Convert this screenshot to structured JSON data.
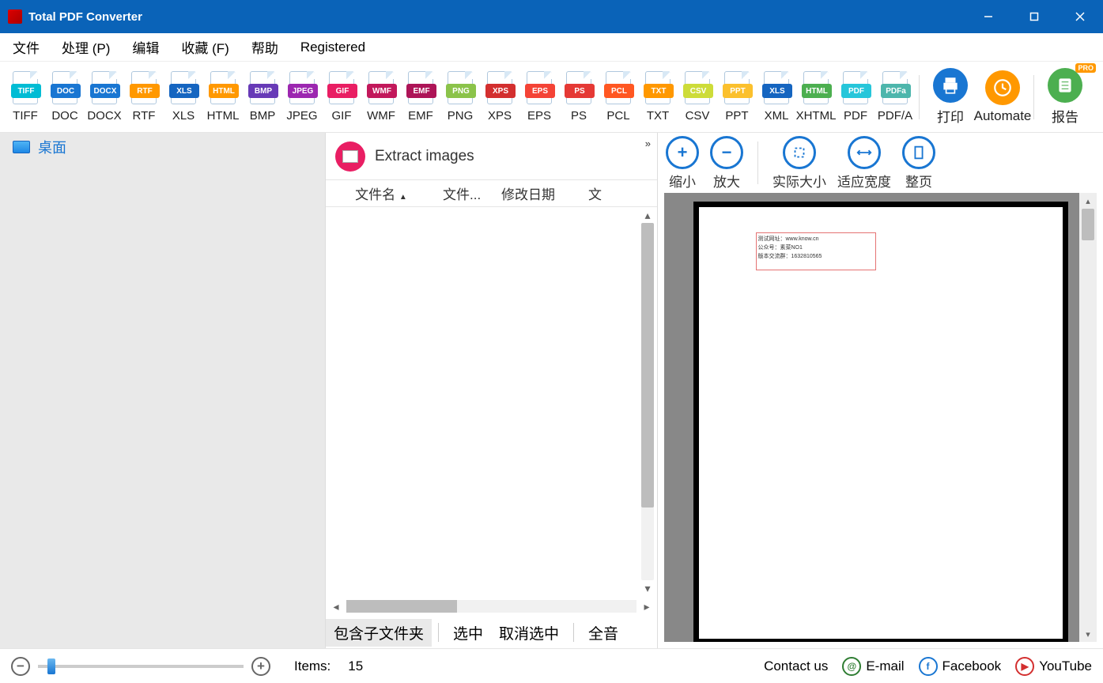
{
  "window": {
    "title": "Total PDF Converter"
  },
  "menu": {
    "file": "文件",
    "process": "处理 (P)",
    "edit": "编辑",
    "favorites": "收藏 (F)",
    "help": "帮助",
    "registered": "Registered"
  },
  "formats": [
    {
      "label": "TIFF",
      "badge": "TIFF",
      "color": "#00bcd4"
    },
    {
      "label": "DOC",
      "badge": "DOC",
      "color": "#1976d2"
    },
    {
      "label": "DOCX",
      "badge": "DOCX",
      "color": "#1976d2"
    },
    {
      "label": "RTF",
      "badge": "RTF",
      "color": "#ff9800"
    },
    {
      "label": "XLS",
      "badge": "XLS",
      "color": "#1565c0"
    },
    {
      "label": "HTML",
      "badge": "HTML",
      "color": "#ff9800"
    },
    {
      "label": "BMP",
      "badge": "BMP",
      "color": "#673ab7"
    },
    {
      "label": "JPEG",
      "badge": "JPEG",
      "color": "#9c27b0"
    },
    {
      "label": "GIF",
      "badge": "GIF",
      "color": "#e91e63"
    },
    {
      "label": "WMF",
      "badge": "WMF",
      "color": "#c2185b"
    },
    {
      "label": "EMF",
      "badge": "EMF",
      "color": "#ad1457"
    },
    {
      "label": "PNG",
      "badge": "PNG",
      "color": "#8bc34a"
    },
    {
      "label": "XPS",
      "badge": "XPS",
      "color": "#d32f2f"
    },
    {
      "label": "EPS",
      "badge": "EPS",
      "color": "#f44336"
    },
    {
      "label": "PS",
      "badge": "PS",
      "color": "#e53935"
    },
    {
      "label": "PCL",
      "badge": "PCL",
      "color": "#ff5722"
    },
    {
      "label": "TXT",
      "badge": "TXT",
      "color": "#ff9800"
    },
    {
      "label": "CSV",
      "badge": "CSV",
      "color": "#cddc39"
    },
    {
      "label": "PPT",
      "badge": "PPT",
      "color": "#fbc02d"
    },
    {
      "label": "XML",
      "badge": "XLS",
      "color": "#1565c0"
    },
    {
      "label": "XHTML",
      "badge": "HTML",
      "color": "#4caf50"
    },
    {
      "label": "PDF",
      "badge": "PDF",
      "color": "#26c6da"
    },
    {
      "label": "PDF/A",
      "badge": "PDFa",
      "color": "#4db6ac"
    }
  ],
  "toolbar_right": {
    "print": "打印",
    "automate": "Automate",
    "report": "报告",
    "pro": "PRO"
  },
  "tree": {
    "desktop": "桌面"
  },
  "middle": {
    "extract": "Extract images",
    "col_name": "文件名",
    "col_file": "文件...",
    "col_modified": "修改日期",
    "col_text": "文",
    "include_sub": "包含子文件夹",
    "select": "选中",
    "deselect": "取消选中",
    "all": "全音"
  },
  "preview": {
    "zoom_out": "缩小",
    "zoom_in": "放大",
    "actual_size": "实际大小",
    "fit_width": "适应宽度",
    "whole_page": "整页",
    "text1": "测试网址：www.know.cn",
    "text2": "公众号：素菜NO1",
    "text3": "版本交流群：1632810565"
  },
  "status": {
    "items_label": "Items:",
    "items_count": "15",
    "contact_us": "Contact us",
    "email": "E-mail",
    "facebook": "Facebook",
    "youtube": "YouTube"
  }
}
